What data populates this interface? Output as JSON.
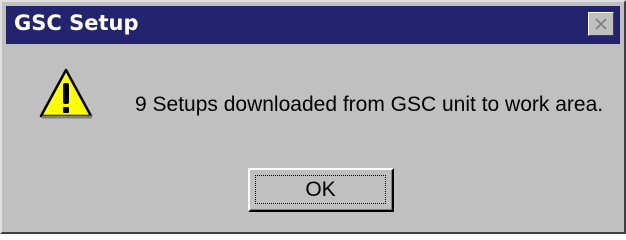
{
  "window": {
    "title": "GSC Setup",
    "title_bar_color": "#24236e"
  },
  "title_bar": {
    "close_icon": "close-icon"
  },
  "dialog": {
    "icon": "warning-icon",
    "message": "9 Setups downloaded from GSC unit to work area.",
    "ok_label": "OK",
    "background_color": "#c0c0c0"
  }
}
